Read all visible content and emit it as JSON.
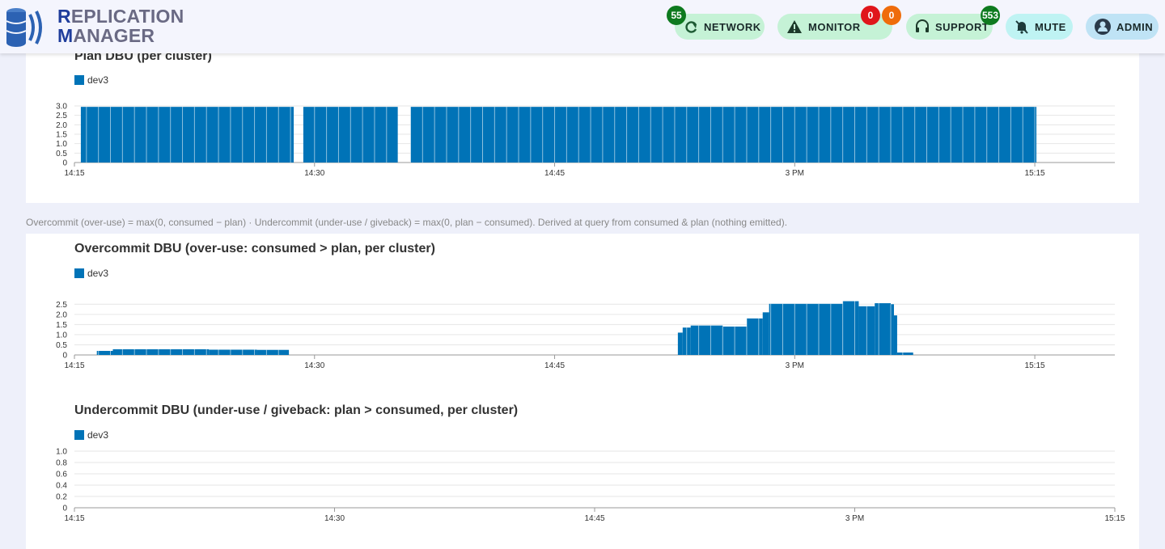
{
  "logo": {
    "line1_cap": "R",
    "line1_rest": "EPLICATION",
    "line2_cap": "M",
    "line2_rest": "ANAGER"
  },
  "nav": {
    "network": {
      "label": "NETWORK",
      "badge": "55"
    },
    "monitor": {
      "label": "MONITOR",
      "badge_red": "0",
      "badge_orange": "0"
    },
    "support": {
      "label": "SUPPORT",
      "badge": "553"
    },
    "mute": {
      "label": "MUTE"
    },
    "admin": {
      "label": "ADMIN"
    }
  },
  "note": "Overcommit (over-use) = max(0, consumed − plan) · Undercommit (under-use / giveback) = max(0, plan − consumed). Derived at query from consumed & plan (nothing emitted).",
  "colors": {
    "series": "#0073b7"
  },
  "chart_data": [
    {
      "type": "bar",
      "title": "Plan DBU (per cluster)",
      "legend": [
        "dev3"
      ],
      "x_ticks": [
        "14:15",
        "14:30",
        "14:45",
        "3 PM",
        "15:15"
      ],
      "y_ticks": [
        "0",
        "0.5",
        "1.0",
        "1.5",
        "2.0",
        "2.5",
        "3.0"
      ],
      "ylim": [
        0,
        3.0
      ],
      "x_range_minutes": [
        0,
        65
      ],
      "series": [
        {
          "name": "dev3",
          "segments": [
            {
              "x_start": 0.4,
              "x_end": 13.7,
              "value": 2.95
            },
            {
              "x_start": 14.3,
              "x_end": 20.2,
              "value": 2.95
            },
            {
              "x_start": 21.0,
              "x_end": 60.1,
              "value": 2.95
            }
          ]
        }
      ],
      "grid": true
    },
    {
      "type": "bar",
      "title": "Overcommit DBU (over-use: consumed > plan, per cluster)",
      "legend": [
        "dev3"
      ],
      "x_ticks": [
        "14:15",
        "14:30",
        "14:45",
        "3 PM",
        "15:15"
      ],
      "y_ticks": [
        "0",
        "0.5",
        "1.0",
        "1.5",
        "2.0",
        "2.5"
      ],
      "ylim": [
        0,
        2.75
      ],
      "x_range_minutes": [
        0,
        65
      ],
      "series": [
        {
          "name": "dev3",
          "segments": [
            {
              "x_start": 1.4,
              "x_end": 2.4,
              "value": 0.2
            },
            {
              "x_start": 2.4,
              "x_end": 8.4,
              "value": 0.28
            },
            {
              "x_start": 8.4,
              "x_end": 11.4,
              "value": 0.26
            },
            {
              "x_start": 11.4,
              "x_end": 13.4,
              "value": 0.25
            },
            {
              "x_start": 37.7,
              "x_end": 38.0,
              "value": 1.1
            },
            {
              "x_start": 38.0,
              "x_end": 38.5,
              "value": 1.35
            },
            {
              "x_start": 38.5,
              "x_end": 40.5,
              "value": 1.45
            },
            {
              "x_start": 40.5,
              "x_end": 42.0,
              "value": 1.4
            },
            {
              "x_start": 42.0,
              "x_end": 43.0,
              "value": 1.8
            },
            {
              "x_start": 43.0,
              "x_end": 43.4,
              "value": 2.1
            },
            {
              "x_start": 43.4,
              "x_end": 48.0,
              "value": 2.52
            },
            {
              "x_start": 48.0,
              "x_end": 49.0,
              "value": 2.65
            },
            {
              "x_start": 49.0,
              "x_end": 50.0,
              "value": 2.4
            },
            {
              "x_start": 50.0,
              "x_end": 51.0,
              "value": 2.55
            },
            {
              "x_start": 51.0,
              "x_end": 51.2,
              "value": 2.5
            },
            {
              "x_start": 51.2,
              "x_end": 51.4,
              "value": 1.95
            },
            {
              "x_start": 51.4,
              "x_end": 52.4,
              "value": 0.12
            }
          ]
        }
      ],
      "grid": true
    },
    {
      "type": "bar",
      "title": "Undercommit DBU (under-use / giveback: plan > consumed, per cluster)",
      "legend": [
        "dev3"
      ],
      "x_ticks": [
        "14:15",
        "14:30",
        "14:45",
        "3 PM",
        "15:15"
      ],
      "y_ticks": [
        "0",
        "0.2",
        "0.4",
        "0.6",
        "0.8",
        "1.0"
      ],
      "ylim": [
        0,
        1.0
      ],
      "x_range_minutes": [
        0,
        60
      ],
      "series": [
        {
          "name": "dev3",
          "segments": []
        }
      ],
      "grid": true
    }
  ]
}
